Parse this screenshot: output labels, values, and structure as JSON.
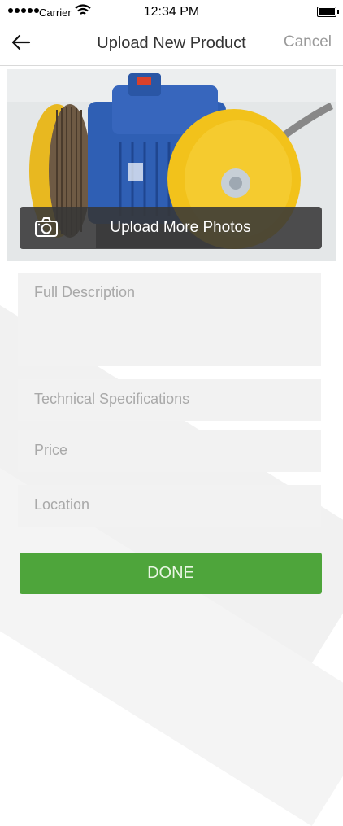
{
  "status_bar": {
    "carrier": "Carrier",
    "time": "12:34 PM"
  },
  "nav": {
    "title": "Upload New Product",
    "cancel_label": "Cancel",
    "back_icon": "arrow-left-icon"
  },
  "photo": {
    "upload_label": "Upload More Photos",
    "camera_icon": "camera-icon"
  },
  "form": {
    "description_placeholder": "Full Description",
    "tech_specs_placeholder": "Technical Specifications",
    "price_placeholder": "Price",
    "location_placeholder": "Location"
  },
  "done_label": "DONE",
  "colors": {
    "accent_green": "#4ea53b",
    "motor_blue": "#2f5fb4",
    "pulley_yellow": "#f2c21b"
  }
}
